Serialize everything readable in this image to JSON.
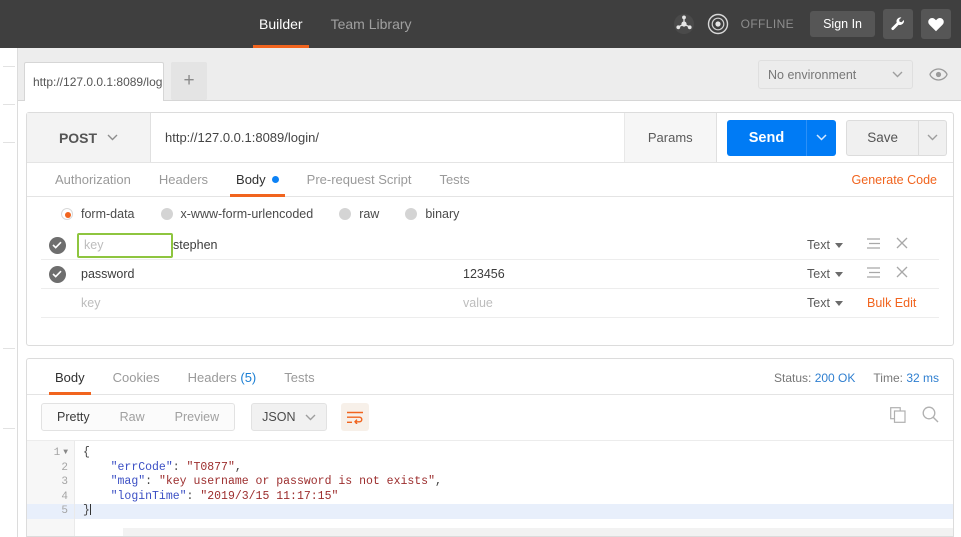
{
  "topbar": {
    "tabs": [
      {
        "label": "Builder",
        "active": true
      },
      {
        "label": "Team Library",
        "active": false
      }
    ],
    "sync_icon": "sync-icon",
    "status_icon": "connection-icon",
    "status_label": "OFFLINE",
    "signin_label": "Sign In",
    "wrench_icon": "wrench-icon",
    "heart_icon": "heart-icon"
  },
  "tabbar": {
    "request_tab_label": "http://127.0.0.1:8089/log",
    "new_tab_label": "+",
    "environment": {
      "selected": "No environment",
      "caret_icon": "chevron-down-icon"
    },
    "eye_icon": "eye-icon"
  },
  "request": {
    "method": "POST",
    "method_caret_icon": "chevron-down-icon",
    "url": "http://127.0.0.1:8089/login/",
    "params_label": "Params",
    "send_label": "Send",
    "send_caret_icon": "chevron-down-icon",
    "save_label": "Save",
    "save_caret_icon": "chevron-down-icon",
    "tabs": [
      {
        "label": "Authorization",
        "active": false
      },
      {
        "label": "Headers",
        "active": false
      },
      {
        "label": "Body",
        "active": true,
        "dot": true
      },
      {
        "label": "Pre-request Script",
        "active": false
      },
      {
        "label": "Tests",
        "active": false
      }
    ],
    "generate_code_label": "Generate Code",
    "body_types": [
      {
        "label": "form-data",
        "selected": true
      },
      {
        "label": "x-www-form-urlencoded",
        "selected": false
      },
      {
        "label": "raw",
        "selected": false
      },
      {
        "label": "binary",
        "selected": false
      }
    ],
    "form_rows": [
      {
        "checked": true,
        "key": "",
        "key_placeholder": "key",
        "key_highlighted": true,
        "value": "stephen",
        "type": "Text",
        "type_caret_icon": "caret-down-icon",
        "menu_icon": "list-menu-icon",
        "remove_icon": "close-icon"
      },
      {
        "checked": true,
        "key": "password",
        "key_placeholder": "key",
        "key_highlighted": false,
        "value": "123456",
        "type": "Text",
        "type_caret_icon": "caret-down-icon",
        "menu_icon": "list-menu-icon",
        "remove_icon": "close-icon"
      },
      {
        "checked": false,
        "key": "",
        "key_placeholder": "key",
        "key_highlighted": false,
        "value": "",
        "value_placeholder": "value",
        "type": "Text",
        "type_caret_icon": "caret-down-icon",
        "bulk_edit_label": "Bulk Edit"
      }
    ]
  },
  "response": {
    "tabs": [
      {
        "label": "Body",
        "active": true
      },
      {
        "label": "Cookies",
        "active": false
      },
      {
        "label": "Headers",
        "active": false,
        "count": "(5)"
      },
      {
        "label": "Tests",
        "active": false
      }
    ],
    "status_label": "Status:",
    "status_value": "200 OK",
    "time_label": "Time:",
    "time_value": "32 ms",
    "view_modes": [
      {
        "label": "Pretty",
        "active": true
      },
      {
        "label": "Raw",
        "active": false
      },
      {
        "label": "Preview",
        "active": false
      }
    ],
    "format": "JSON",
    "format_caret_icon": "chevron-down-icon",
    "wrap_icon": "word-wrap-icon",
    "copy_icon": "copy-icon",
    "search_icon": "search-icon",
    "body_lines": [
      {
        "number": "1",
        "foldable": true,
        "active": false
      },
      {
        "number": "2",
        "foldable": false,
        "active": false
      },
      {
        "number": "3",
        "foldable": false,
        "active": false
      },
      {
        "number": "4",
        "foldable": false,
        "active": false
      },
      {
        "number": "5",
        "foldable": false,
        "active": true
      }
    ],
    "json": {
      "errCode_key": "\"errCode\"",
      "errCode_val": "\"T0877\"",
      "mag_key": "\"mag\"",
      "mag_val": "\"key username or password is not exists\"",
      "loginTime_key": "\"loginTime\"",
      "loginTime_val": "\"2019/3/15 11:17:15\"",
      "open_brace": "{",
      "close_brace": "}"
    }
  },
  "colors": {
    "accent_orange": "#f1641e",
    "send_blue": "#007bf5",
    "highlight_green": "#8ec53f",
    "status_blue": "#2f7fd0",
    "header_dark": "#3f3f3f"
  }
}
